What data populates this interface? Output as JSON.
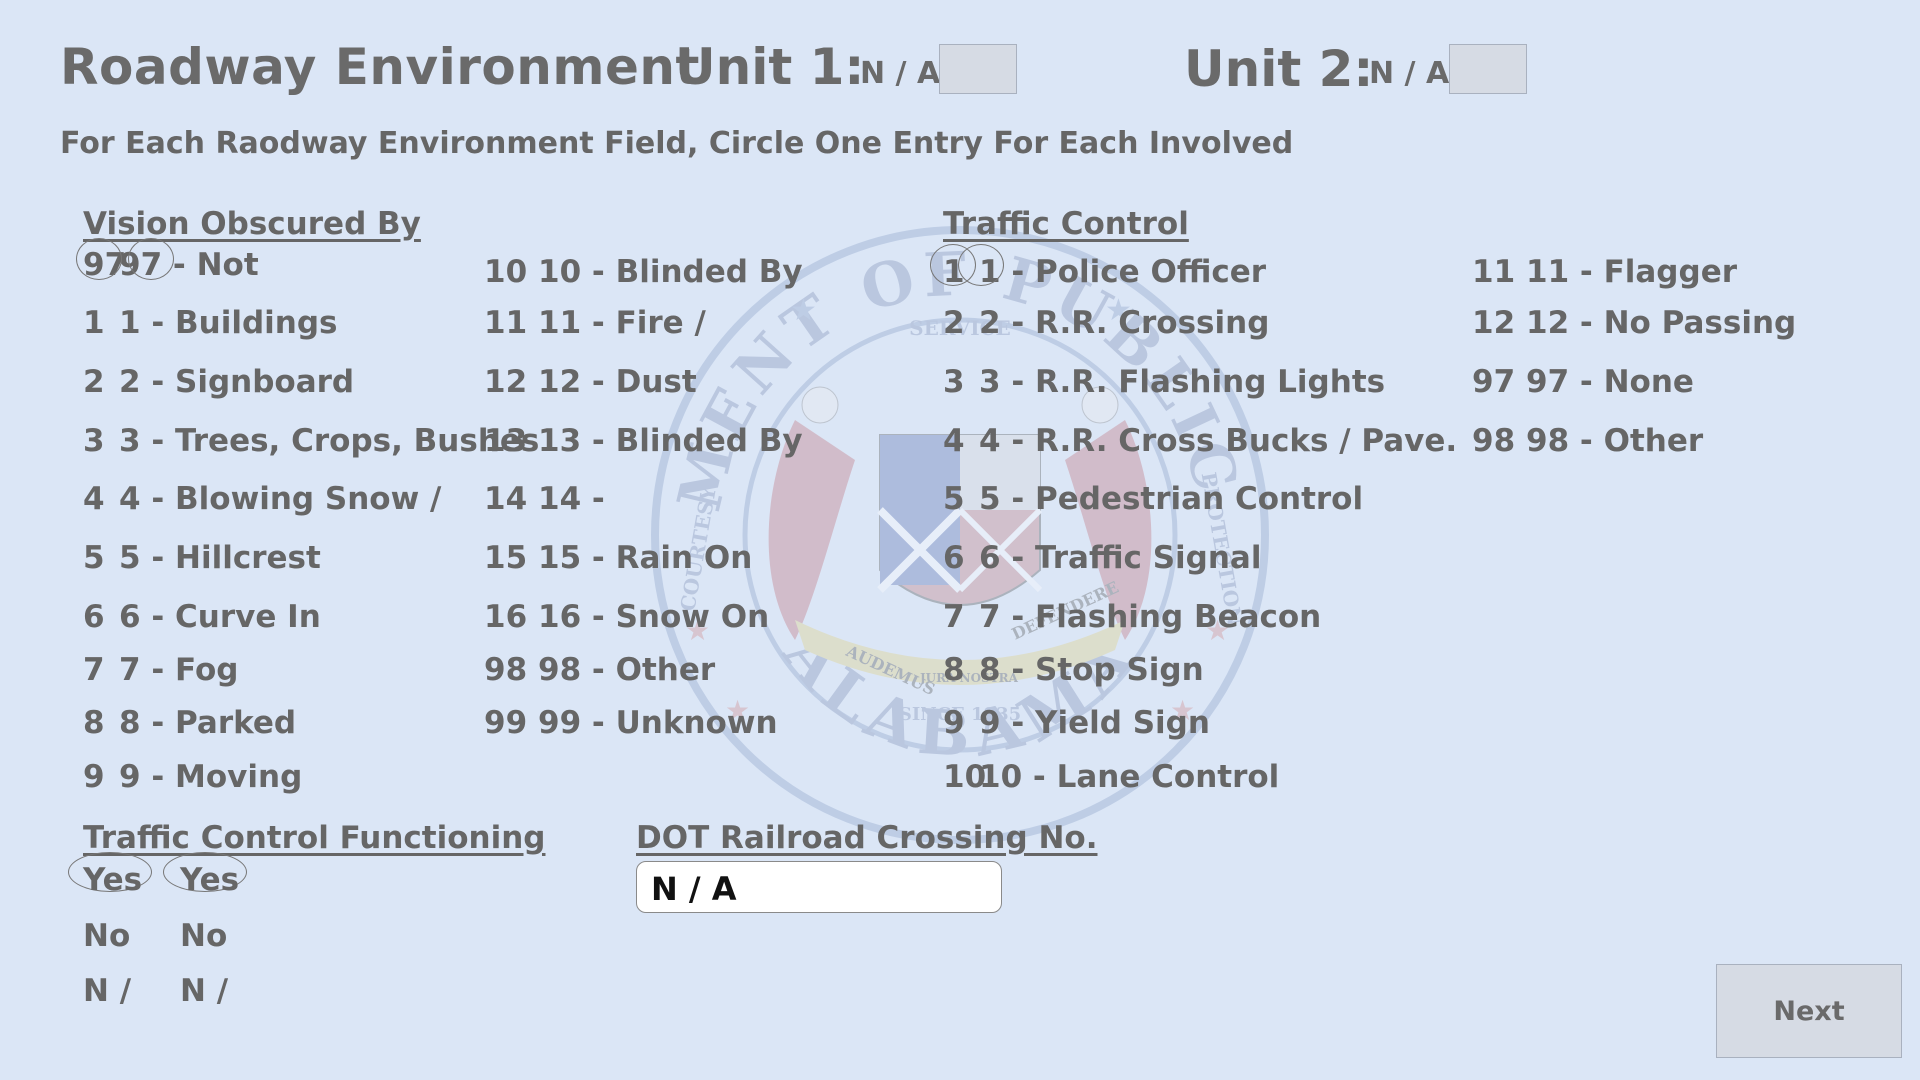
{
  "header": {
    "title": "Roadway Environment",
    "unit1_label": "Unit 1:",
    "unit1_value": "N / A",
    "unit2_label": "Unit 2:",
    "unit2_value": "N / A",
    "instruction": "For Each Raodway Environment Field, Circle One Entry For Each Involved"
  },
  "vision_obscured": {
    "heading": "Vision Obscured By",
    "col1": [
      {
        "code": "97",
        "label": "97 - Not"
      },
      {
        "code": "1",
        "label": "1 - Buildings"
      },
      {
        "code": "2",
        "label": "2 - Signboard"
      },
      {
        "code": "3",
        "label": "3 - Trees, Crops, Bushes"
      },
      {
        "code": "4",
        "label": "4 - Blowing Snow /"
      },
      {
        "code": "5",
        "label": "5 - Hillcrest"
      },
      {
        "code": "6",
        "label": "6 - Curve In"
      },
      {
        "code": "7",
        "label": "7 - Fog"
      },
      {
        "code": "8",
        "label": "8 - Parked"
      },
      {
        "code": "9",
        "label": "9 - Moving"
      }
    ],
    "col2": [
      {
        "code": "10",
        "label": "10 - Blinded By"
      },
      {
        "code": "11",
        "label": "11 - Fire /"
      },
      {
        "code": "12",
        "label": "12 - Dust"
      },
      {
        "code": "13",
        "label": "13 - Blinded By"
      },
      {
        "code": "14",
        "label": "14 -"
      },
      {
        "code": "15",
        "label": "15 - Rain On"
      },
      {
        "code": "16",
        "label": "16 - Snow On"
      },
      {
        "code": "98",
        "label": "98 - Other"
      },
      {
        "code": "99",
        "label": "99 - Unknown"
      }
    ]
  },
  "traffic_control": {
    "heading": "Traffic Control",
    "col1": [
      {
        "code": "1",
        "label": "1 - Police Officer"
      },
      {
        "code": "2",
        "label": "2 - R.R. Crossing"
      },
      {
        "code": "3",
        "label": "3 - R.R. Flashing Lights"
      },
      {
        "code": "4",
        "label": "4 - R.R. Cross Bucks / Pave."
      },
      {
        "code": "5",
        "label": "5 - Pedestrian Control"
      },
      {
        "code": "6",
        "label": "6 - Traffic Signal"
      },
      {
        "code": "7",
        "label": "7 - Flashing Beacon"
      },
      {
        "code": "8",
        "label": "8 - Stop Sign"
      },
      {
        "code": "9",
        "label": "9 - Yield Sign"
      },
      {
        "code": "10",
        "label": "10 - Lane Control"
      }
    ],
    "col2": [
      {
        "code": "11",
        "label": "11 - Flagger"
      },
      {
        "code": "12",
        "label": "12 - No Passing"
      },
      {
        "code": "97",
        "label": "97 - None"
      },
      {
        "code": "98",
        "label": "98 - Other"
      }
    ]
  },
  "functioning": {
    "heading": "Traffic Control Functioning",
    "unit1": [
      "Yes",
      "No",
      "N /"
    ],
    "unit2": [
      "Yes",
      "No",
      "N /"
    ]
  },
  "railroad": {
    "heading": "DOT Railroad Crossing No.",
    "value": "N / A"
  },
  "next_label": "Next",
  "seal_text": {
    "top": "DEPARTMENT OF PUBLIC SAFETY",
    "bottom": "ALABAMA",
    "left": "COURTESY",
    "right": "PROTECTION",
    "service": "SERVICE",
    "motto1": "AUDEMUS",
    "motto2": "DEFENDERE",
    "motto3": "JURA NOSTRA",
    "since": "SINCE 1935"
  }
}
